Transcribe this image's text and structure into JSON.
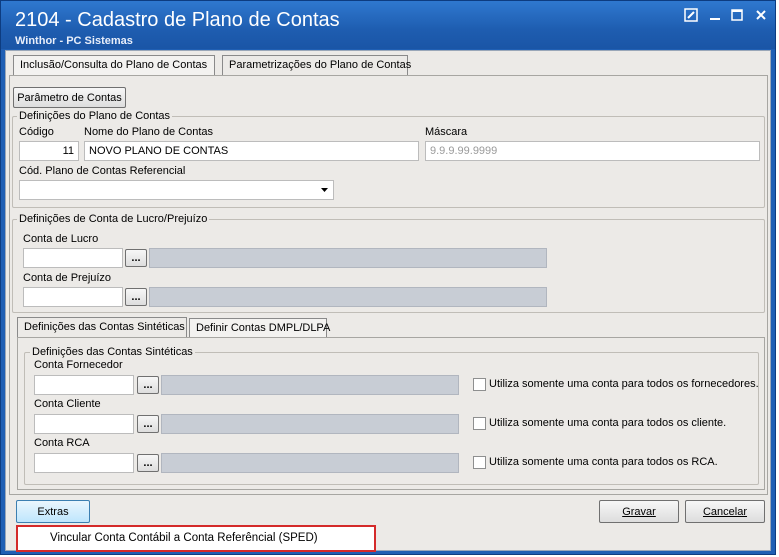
{
  "window": {
    "title": "2104 - Cadastro de Plano de Contas",
    "subtitle": "Winthor - PC Sistemas"
  },
  "tabs": [
    {
      "label": "Inclusão/Consulta do Plano de Contas"
    },
    {
      "label": "Parametrizações do Plano de Contas"
    }
  ],
  "toolbar": {
    "parametro_label": "Parâmetro de Contas"
  },
  "definicoes": {
    "legend": "Definições do Plano de Contas",
    "codigo_label": "Código",
    "codigo_value": "11",
    "nome_label": "Nome do Plano de Contas",
    "nome_value": "NOVO PLANO DE CONTAS",
    "mascara_label": "Máscara",
    "mascara_placeholder": "9.9.9.99.9999",
    "ref_label": "Cód. Plano de Contas Referencial",
    "ref_value": ""
  },
  "lucro": {
    "legend": "Definições de Conta de Lucro/Prejuízo",
    "lucro_label": "Conta de Lucro",
    "prejuizo_label": "Conta de Prejuízo",
    "browse": "..."
  },
  "subtabs": [
    {
      "label": "Definições das Contas Sintéticas"
    },
    {
      "label": "Definir Contas DMPL/DLPA"
    }
  ],
  "sinteticas": {
    "legend": "Definições das Contas Sintéticas",
    "fornecedor_label": "Conta Fornecedor",
    "fornecedor_check": "Utiliza somente uma conta para todos os fornecedores.",
    "cliente_label": "Conta Cliente",
    "cliente_check": "Utiliza somente uma conta para todos os cliente.",
    "rca_label": "Conta RCA",
    "rca_check": "Utiliza somente uma conta para todos os RCA."
  },
  "footer": {
    "extras": "Extras",
    "gravar": "Gravar",
    "cancelar": "Cancelar"
  },
  "menu": {
    "item": "Vincular Conta Contábil a Conta Referêncial (SPED)"
  },
  "colors": {
    "title_bar": "#1f5fb4",
    "menu_highlight_border": "#d42a2a"
  }
}
